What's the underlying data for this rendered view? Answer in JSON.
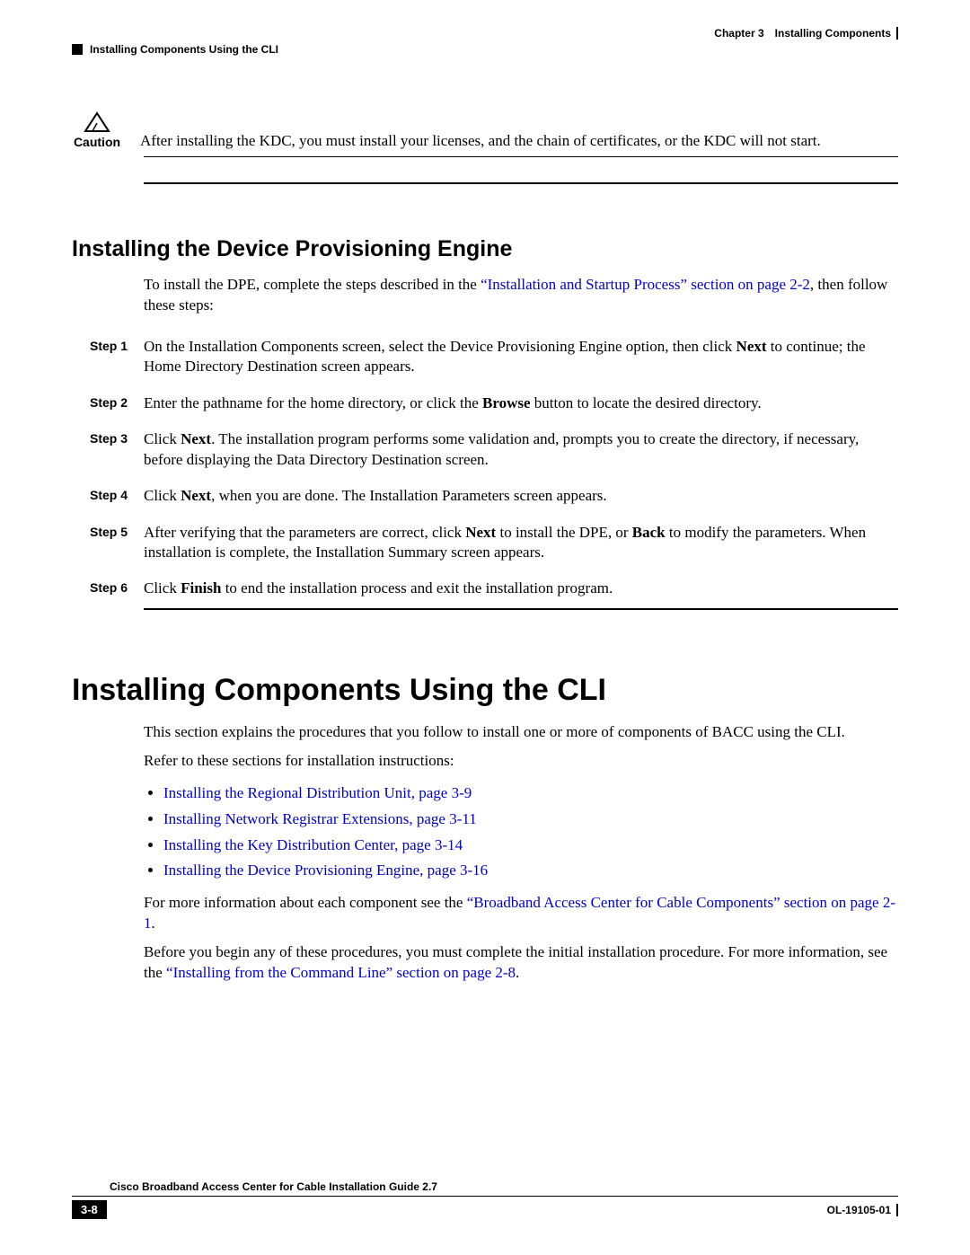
{
  "header": {
    "chapter_num": "Chapter 3",
    "chapter_title": "Installing Components",
    "section_title": "Installing Components Using the CLI"
  },
  "caution": {
    "label": "Caution",
    "text": "After installing the KDC, you must install your licenses, and the chain of certificates, or the KDC will not start."
  },
  "section_dpe": {
    "heading": "Installing the Device Provisioning Engine",
    "intro_pre": "To install the DPE, complete the steps described in the ",
    "intro_link": "“Installation and Startup Process” section on page 2-2",
    "intro_post": ", then follow these steps:",
    "steps": [
      {
        "label": "Step 1",
        "pre": "On the Installation Components screen, select the Device Provisioning Engine option, then click ",
        "bold": "Next",
        "post": " to continue; the Home Directory Destination screen appears."
      },
      {
        "label": "Step 2",
        "pre": "Enter the pathname for the home directory, or click the ",
        "bold": "Browse",
        "post": " button to locate the desired directory."
      },
      {
        "label": "Step 3",
        "pre": "Click ",
        "bold": "Next",
        "post": ". The installation program performs some validation and, prompts you to create the directory, if necessary, before displaying the Data Directory Destination screen."
      },
      {
        "label": "Step 4",
        "pre": "Click ",
        "bold": "Next",
        "post": ", when you are done. The Installation Parameters screen appears."
      },
      {
        "label": "Step 5",
        "pre": "After verifying that the parameters are correct, click ",
        "bold": "Next",
        "post_mid": " to install the DPE, or ",
        "bold2": "Back",
        "post": " to modify the parameters. When installation is complete, the Installation Summary screen appears."
      },
      {
        "label": "Step 6",
        "pre": "Click ",
        "bold": "Finish",
        "post": " to end the installation process and exit the installation program."
      }
    ]
  },
  "section_cli": {
    "heading": "Installing Components Using the CLI",
    "para1": "This section explains the procedures that you follow to install one or more of components of BACC using the CLI.",
    "para2": "Refer to these sections for installation instructions:",
    "bullets": [
      "Installing the Regional Distribution Unit, page 3-9",
      "Installing Network Registrar Extensions, page 3-11",
      "Installing the Key Distribution Center, page 3-14",
      "Installing the Device Provisioning Engine, page 3-16"
    ],
    "more_pre": "For more information about each component see the ",
    "more_link": "“Broadband Access Center for Cable Components” section on page 2-1",
    "more_post": ".",
    "begin_pre": "Before you begin any of these procedures, you must complete the initial installation procedure. For more information, see the ",
    "begin_link": "“Installing from the Command Line” section on page 2-8",
    "begin_post": "."
  },
  "footer": {
    "guide": "Cisco Broadband Access Center for Cable Installation Guide 2.7",
    "page": "3-8",
    "docid": "OL-19105-01"
  }
}
